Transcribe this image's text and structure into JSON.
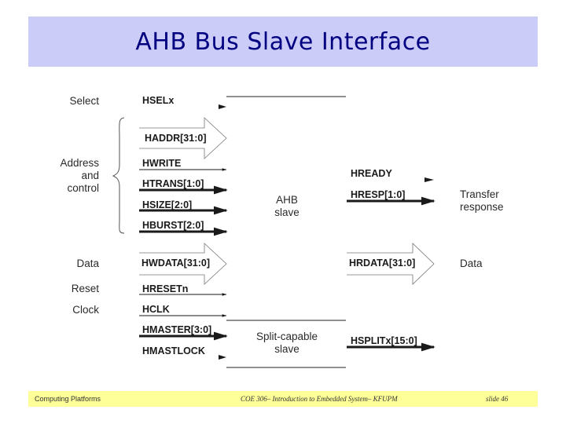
{
  "title": "AHB Bus Slave Interface",
  "diagram": {
    "left_groups": {
      "select": "Select",
      "address_control": [
        "Address",
        "and",
        "control"
      ],
      "data": "Data",
      "reset": "Reset",
      "clock": "Clock"
    },
    "inputs": {
      "hsel": "HSELx",
      "haddr": "HADDR[31:0]",
      "hwrite": "HWRITE",
      "htrans": "HTRANS[1:0]",
      "hsize": "HSIZE[2:0]",
      "hburst": "HBURST[2:0]",
      "hwdata": "HWDATA[31:0]",
      "hresetn": "HRESETn",
      "hclk": "HCLK",
      "hmaster": "HMASTER[3:0]",
      "hmastlock": "HMASTLOCK"
    },
    "blocks": {
      "ahb_slave": [
        "AHB",
        "slave"
      ],
      "split_slave": [
        "Split-capable",
        "slave"
      ]
    },
    "outputs": {
      "hready": "HREADY",
      "hresp": "HRESP[1:0]",
      "hrdata": "HRDATA[31:0]",
      "hsplit": "HSPLITx[15:0]"
    },
    "right_groups": {
      "transfer_response": [
        "Transfer",
        "response"
      ],
      "data": "Data"
    }
  },
  "footer": {
    "left": "Computing Platforms",
    "center": "COE 306– Introduction to Embedded System– KFUPM",
    "right": "slide 46"
  }
}
